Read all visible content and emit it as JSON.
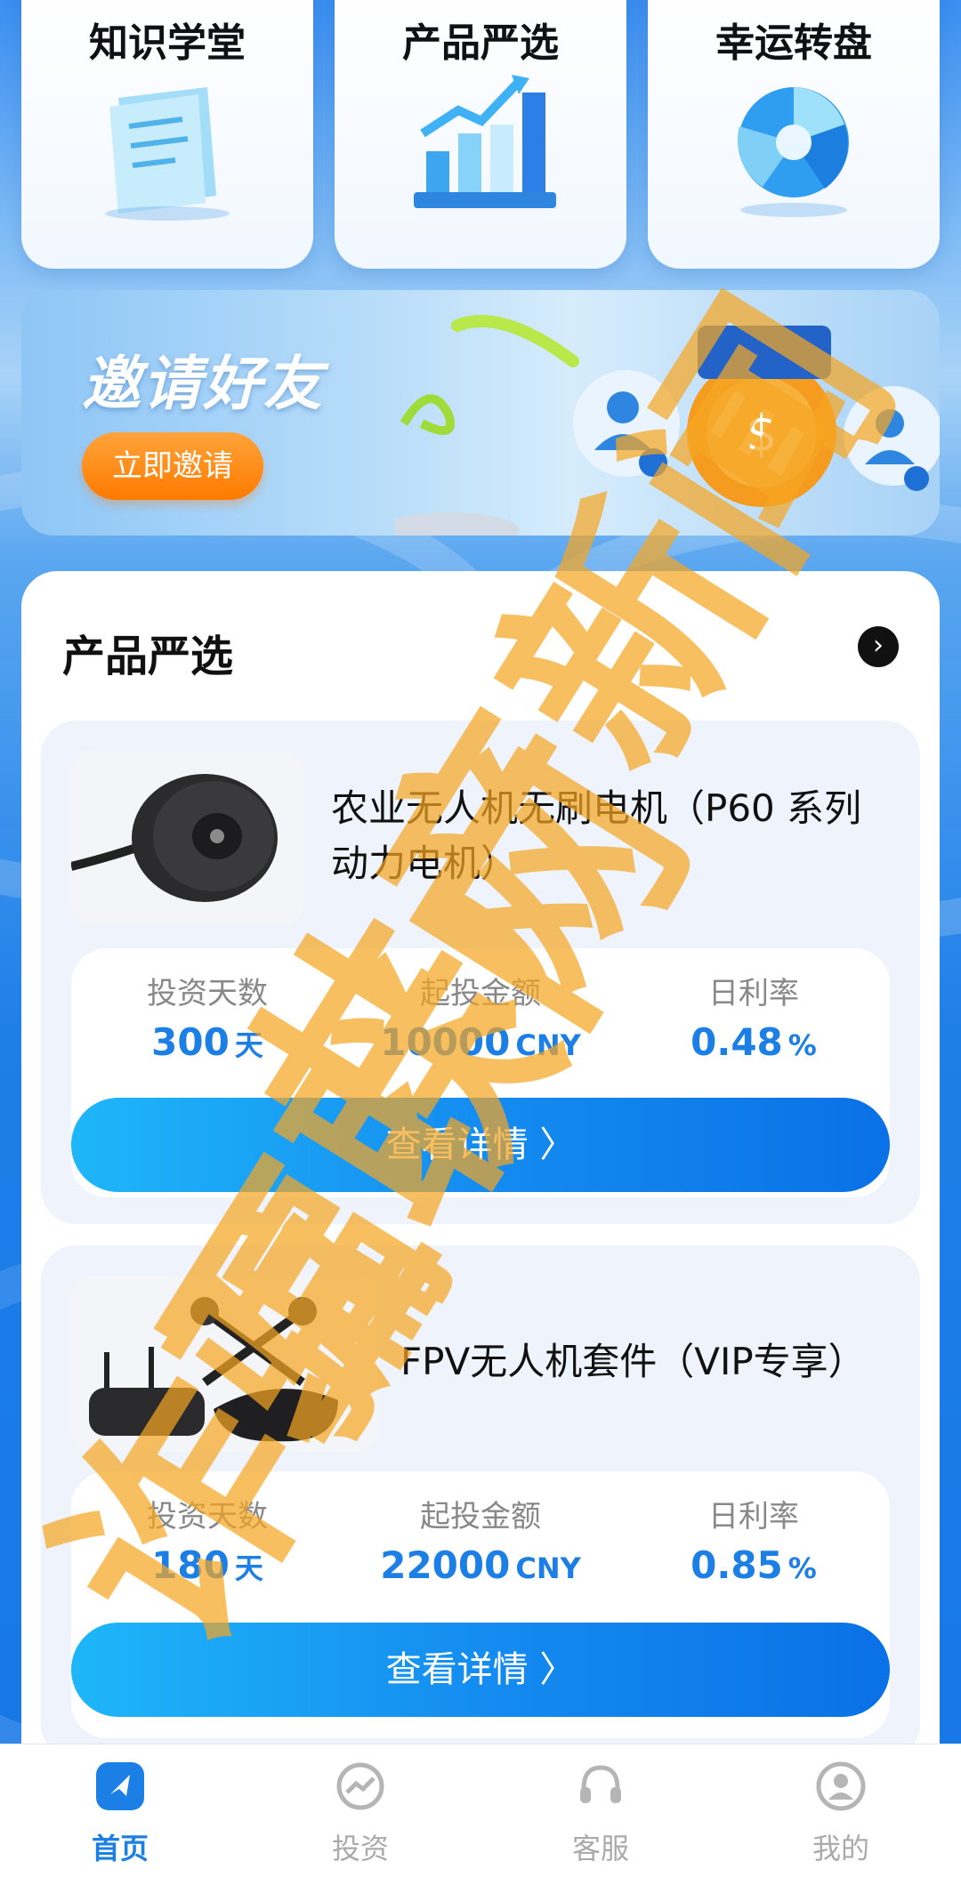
{
  "top_menu": [
    {
      "label": "知识学堂",
      "icon": "document-icon"
    },
    {
      "label": "产品严选",
      "icon": "bar-chart-icon"
    },
    {
      "label": "幸运转盘",
      "icon": "wheel-icon"
    }
  ],
  "invite": {
    "title": "邀请好友",
    "button": "立即邀请"
  },
  "products_section": {
    "title": "产品严选",
    "more_icon": "chevron-right-icon",
    "items": [
      {
        "name_line1": "农业无人机无刷电机（P60 系列",
        "name_line2": "动力电机）",
        "image": "motor-image",
        "stats": [
          {
            "label": "投资天数",
            "value": "300",
            "unit": "天"
          },
          {
            "label": "起投金额",
            "value": "10000",
            "unit": "CNY"
          },
          {
            "label": "日利率",
            "value": "0.48",
            "unit": "%"
          }
        ],
        "button": "查看详情 〉"
      },
      {
        "name_line1": "FPV无人机套件（VIP专享）",
        "name_line2": "",
        "image": "fpv-kit-image",
        "stats": [
          {
            "label": "投资天数",
            "value": "180",
            "unit": "天"
          },
          {
            "label": "起投金额",
            "value": "22000",
            "unit": "CNY"
          },
          {
            "label": "日利率",
            "value": "0.85",
            "unit": "%"
          }
        ],
        "button": "查看详情 〉"
      }
    ]
  },
  "watermark": {
    "line1": "共产新闻",
    "line2": "互联网",
    "line3": "诈骗",
    "color": "#f5a623"
  },
  "tabbar": [
    {
      "label": "首页",
      "icon": "home-icon",
      "active": true
    },
    {
      "label": "投资",
      "icon": "invest-icon",
      "active": false
    },
    {
      "label": "客服",
      "icon": "headset-icon",
      "active": false
    },
    {
      "label": "我的",
      "icon": "user-icon",
      "active": false
    }
  ],
  "colors": {
    "accent": "#1b7fe6",
    "button_orange": "#ff7a00"
  }
}
